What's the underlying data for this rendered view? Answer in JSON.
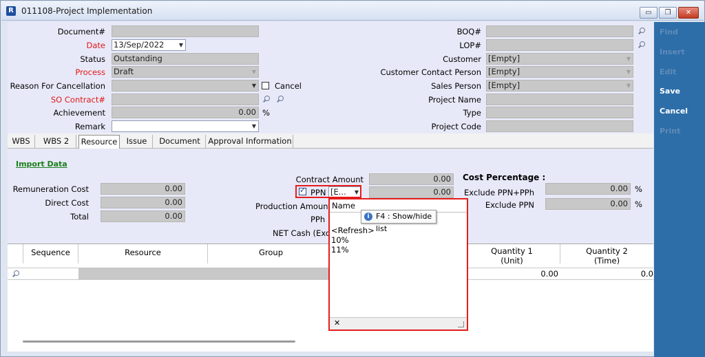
{
  "window": {
    "title": "011108-Project Implementation",
    "app_icon": "R",
    "minimize_glyph": "▭",
    "restore_glyph": "❐",
    "close_glyph": "✕"
  },
  "form": {
    "document_label": "Document#",
    "date_label": "Date",
    "date_value": "13/Sep/2022",
    "status_label": "Status",
    "status_value": "Outstanding",
    "process_label": "Process",
    "process_value": "Draft",
    "reason_label": "Reason For Cancellation",
    "cancel_label": "Cancel",
    "so_contract_label": "SO Contract#",
    "achievement_label": "Achievement",
    "achievement_value": "0.00",
    "achievement_unit": "%",
    "remark_label": "Remark",
    "boq_label": "BOQ#",
    "lop_label": "LOP#",
    "customer_label": "Customer",
    "customer_value": "[Empty]",
    "contact_label": "Customer Contact Person",
    "contact_value": "[Empty]",
    "sales_label": "Sales Person",
    "sales_value": "[Empty]",
    "project_name_label": "Project Name",
    "type_label": "Type",
    "project_code_label": "Project Code"
  },
  "tabs": [
    "WBS",
    "WBS 2",
    "Resource",
    "Issue",
    "Document",
    "Approval Information"
  ],
  "resource": {
    "import_data": "Import Data",
    "remuneration_label": "Remuneration Cost",
    "remuneration_value": "0.00",
    "direct_label": "Direct Cost",
    "direct_value": "0.00",
    "total_label": "Total",
    "total_value": "0.00",
    "contract_label": "Contract Amount",
    "contract_value": "0.00",
    "ppn_label": "PPN",
    "ppn_value": "[E...",
    "ppn_amount": "0.00",
    "production_label": "Production Amount(",
    "pph_label": "PPh",
    "net_cash_label": "NET Cash (Excl",
    "cost_pct_label": "Cost Percentage :",
    "excl_ppn_pph_label": "Exclude PPN+PPh",
    "excl_ppn_pph_value": "0.00",
    "excl_ppn_label": "Exclude PPN",
    "excl_ppn_value": "0.00",
    "pct_unit": "%"
  },
  "grid": {
    "columns": [
      "Sequence",
      "Resource",
      "Group",
      "Quantity 1 (Unit)",
      "Quantity 2 (Time)"
    ],
    "qty1_line1": "Quantity 1",
    "qty1_line2": "(Unit)",
    "qty2_line1": "Quantity 2",
    "qty2_line2": "(Time)",
    "row_qty1": "0.00",
    "row_qty2": "0.0"
  },
  "dropdown_popup": {
    "header": "Name",
    "items": [
      "<Refresh>",
      "10%",
      "11%"
    ],
    "close_glyph": "✕",
    "tooltip": "F4 : Show/hide list",
    "info_glyph": "i"
  },
  "sidebar": {
    "find": "Find",
    "insert": "Insert",
    "edit": "Edit",
    "save": "Save",
    "cancel": "Cancel",
    "print": "Print"
  },
  "colors": {
    "required_label": "#e01818",
    "highlight_border": "#e51c1c",
    "sidebar_bg": "#2d6ea8",
    "link_green": "#1a7f1a"
  }
}
